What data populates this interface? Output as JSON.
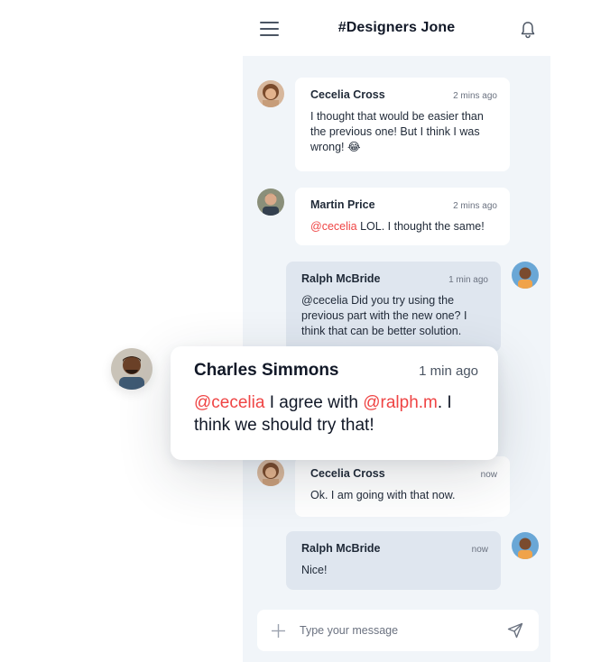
{
  "header": {
    "title": "#Designers Jone",
    "menu_icon": "menu-icon",
    "bell_icon": "bell-icon"
  },
  "messages": [
    {
      "sender": "Cecelia Cross",
      "time": "2 mins ago",
      "text": "I thought that would be easier than the previous one! But I think I was wrong! 😂",
      "direction": "incoming"
    },
    {
      "sender": "Martin Price",
      "time": "2 mins ago",
      "mention": "@cecelia",
      "text": " LOL. I thought the same!",
      "direction": "incoming"
    },
    {
      "sender": "Ralph McBride",
      "time": "1 min ago",
      "text": "@cecelia Did you try using the previous part with the new one? I think that can be better solution.",
      "direction": "outgoing"
    },
    {
      "sender": "Cecelia Cross",
      "time": "now",
      "text": "Ok. I am going with that now.",
      "direction": "incoming"
    },
    {
      "sender": "Ralph McBride",
      "time": "now",
      "text": "Nice!",
      "direction": "outgoing"
    }
  ],
  "featured": {
    "sender": "Charles Simmons",
    "time": "1 min ago",
    "mention1": "@cecelia",
    "text1": " I agree with ",
    "mention2": "@ralph.m",
    "text2": ". I think we should try that!"
  },
  "composer": {
    "placeholder": "Type your message",
    "plus_icon": "plus-icon",
    "send_icon": "send-icon"
  },
  "colors": {
    "mention": "#ef4444",
    "panel_bg": "#f1f5f9",
    "outgoing_bubble": "#dfe6ef"
  }
}
